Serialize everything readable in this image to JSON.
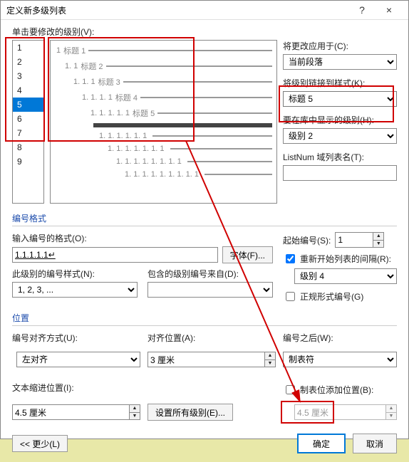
{
  "titlebar": {
    "title": "定义新多级列表",
    "help": "?",
    "close": "×"
  },
  "top": {
    "levelsLabel": "单击要修改的级别(V):",
    "levels": [
      "1",
      "2",
      "3",
      "4",
      "5",
      "6",
      "7",
      "8",
      "9"
    ],
    "selectedLevel": "5",
    "preview": [
      {
        "indent": 0,
        "num": "1",
        "label": "标题 1",
        "thick": false
      },
      {
        "indent": 1,
        "num": "1. 1",
        "label": "标题 2",
        "thick": false
      },
      {
        "indent": 2,
        "num": "1. 1. 1",
        "label": "标题 3",
        "thick": false
      },
      {
        "indent": 3,
        "num": "1. 1. 1. 1",
        "label": "标题 4",
        "thick": false
      },
      {
        "indent": 4,
        "num": "1. 1. 1. 1. 1",
        "label": "标题 5",
        "thick": false
      },
      {
        "indent": 4,
        "num": "",
        "label": "",
        "thick": true
      },
      {
        "indent": 5,
        "num": "1. 1. 1. 1. 1. 1",
        "label": "",
        "thick": false
      },
      {
        "indent": 6,
        "num": "1. 1. 1. 1. 1. 1. 1",
        "label": "",
        "thick": false
      },
      {
        "indent": 7,
        "num": "1. 1. 1. 1. 1. 1. 1. 1",
        "label": "",
        "thick": false
      },
      {
        "indent": 8,
        "num": "1. 1. 1. 1. 1. 1. 1. 1. 1",
        "label": "",
        "thick": false
      }
    ],
    "applyToLabel": "将更改应用于(C):",
    "applyTo": "当前段落",
    "linkStyleLabel": "将级别链接到样式(K):",
    "linkStyle": "标题 5",
    "galleryLabel": "要在库中显示的级别(H):",
    "gallery": "级别 2",
    "listNumLabel": "ListNum 域列表名(T):",
    "listNum": ""
  },
  "fmt": {
    "section": "编号格式",
    "numFormatLabel": "输入编号的格式(O):",
    "numFormat": "1.1.1.1.1↵",
    "fontBtn": "字体(F)...",
    "numStyleLabel": "此级别的编号样式(N):",
    "numStyle": "1, 2, 3, ...",
    "includeLabel": "包含的级别编号来自(D):",
    "include": "",
    "startAtLabel": "起始编号(S):",
    "startAt": "1",
    "restartChk": true,
    "restartLabel": "重新开始列表的间隔(R):",
    "restartLevel": "级别 4",
    "legalChk": false,
    "legalLabel": "正规形式编号(G)"
  },
  "pos": {
    "section": "位置",
    "alignLabel": "编号对齐方式(U):",
    "align": "左对齐",
    "alignAtLabel": "对齐位置(A):",
    "alignAt": "3 厘米",
    "indentLabel": "文本缩进位置(I):",
    "indent": "4.5 厘米",
    "setAllBtn": "设置所有级别(E)...",
    "followLabel": "编号之后(W):",
    "follow": "制表符",
    "tabChk": false,
    "tabLabel": "制表位添加位置(B):",
    "tabAt": "4.5 厘米"
  },
  "footer": {
    "less": "<< 更少(L)",
    "ok": "确定",
    "cancel": "取消"
  }
}
